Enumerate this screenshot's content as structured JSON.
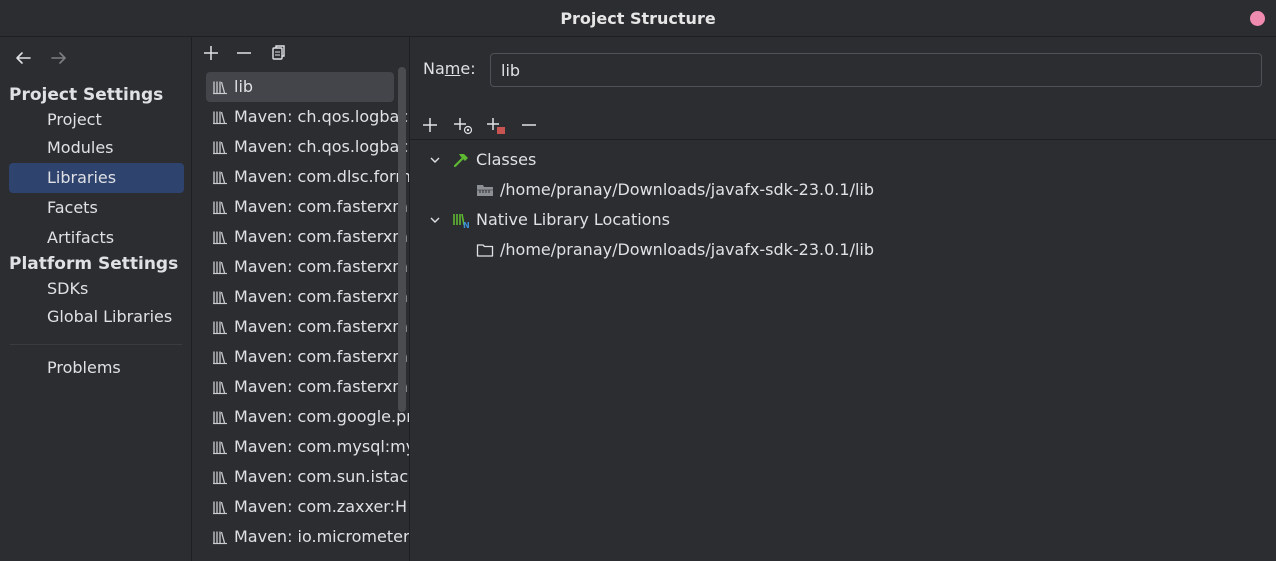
{
  "window": {
    "title": "Project Structure"
  },
  "nav": {
    "sections": [
      {
        "label": "Project Settings",
        "items": [
          "Project",
          "Modules",
          "Libraries",
          "Facets",
          "Artifacts"
        ]
      },
      {
        "label": "Platform Settings",
        "items": [
          "SDKs",
          "Global Libraries"
        ]
      }
    ],
    "problems": "Problems",
    "selected": "Libraries"
  },
  "libraries": [
    "lib",
    "Maven: ch.qos.logbac",
    "Maven: ch.qos.logbac",
    "Maven: com.dlsc.form",
    "Maven: com.fasterxm",
    "Maven: com.fasterxm",
    "Maven: com.fasterxm",
    "Maven: com.fasterxm",
    "Maven: com.fasterxm",
    "Maven: com.fasterxm",
    "Maven: com.fasterxm",
    "Maven: com.google.pr",
    "Maven: com.mysql:my",
    "Maven: com.sun.istac",
    "Maven: com.zaxxer:H",
    "Maven: io.micrometer"
  ],
  "detail": {
    "name_label_pre": "Na",
    "name_label_u": "m",
    "name_label_post": "e:",
    "name_value": "lib",
    "tree": {
      "classes_label": "Classes",
      "classes_path": "/home/pranay/Downloads/javafx-sdk-23.0.1/lib",
      "native_label": "Native Library Locations",
      "native_path": "/home/pranay/Downloads/javafx-sdk-23.0.1/lib"
    }
  },
  "colors": {
    "accent_selected": "#2e436e",
    "close_button": "#f08bb0",
    "classes_icon": "#5fb832",
    "add_remove_accent": "#c75450"
  }
}
